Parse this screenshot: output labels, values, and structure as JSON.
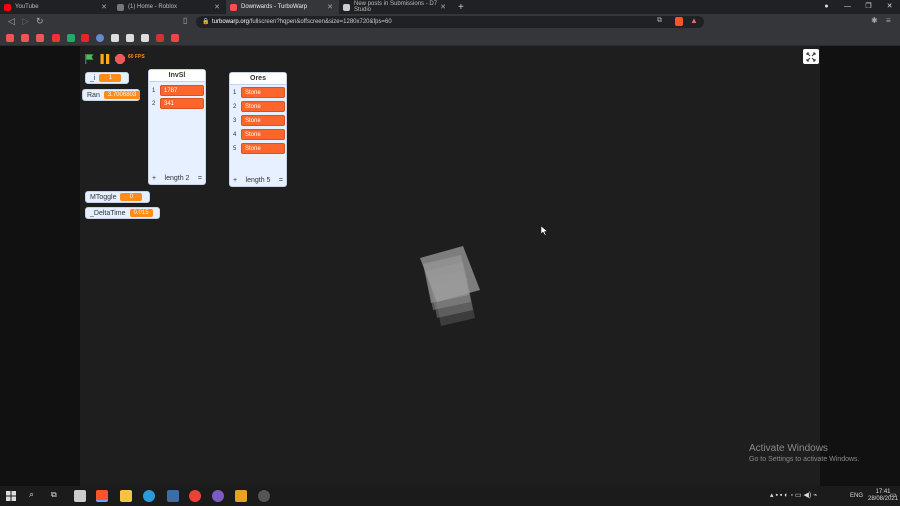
{
  "browser": {
    "tabs": [
      {
        "title": "YouTube",
        "active": false,
        "color": "#ff0000"
      },
      {
        "title": "(1) Home - Roblox",
        "active": false,
        "color": "#888888"
      },
      {
        "title": "Downwards - TurboWarp",
        "active": true,
        "color": "#ff4c4c"
      },
      {
        "title": "New posts in Submissions - D7 Studio",
        "active": false,
        "color": "#cccccc"
      }
    ],
    "url_host": "turbowarp.org",
    "url_path": "/fullscreen?hqpen&offscreen&size=1280x720&fps=60"
  },
  "player": {
    "fps_label": "60 FPS",
    "monitors": [
      {
        "label": "_i",
        "value": "1"
      },
      {
        "label": "Ran",
        "value": "3.7006803"
      },
      {
        "label": "MToggle",
        "value": "0"
      },
      {
        "label": "_DeltaTime",
        "value": "0.015"
      }
    ],
    "lists": [
      {
        "title": "InvSl",
        "items": [
          "1787",
          "341"
        ],
        "footer": "length 2"
      },
      {
        "title": "Ores",
        "items": [
          "Stone",
          "Stone",
          "Stone",
          "Stone",
          "Stone"
        ],
        "footer": "length 5"
      }
    ],
    "list_add": "+",
    "list_resize": "="
  },
  "watermark": {
    "line1": "Activate Windows",
    "line2": "Go to Settings to activate Windows."
  },
  "tray": {
    "lang": "ENG",
    "time": "17:41",
    "date": "28/08/2021"
  },
  "colors": {
    "accent": "#ff8c1a",
    "list_cell": "#fc662c",
    "monitor_bg": "#e6f0ff",
    "stage": "#1e1e1e"
  }
}
